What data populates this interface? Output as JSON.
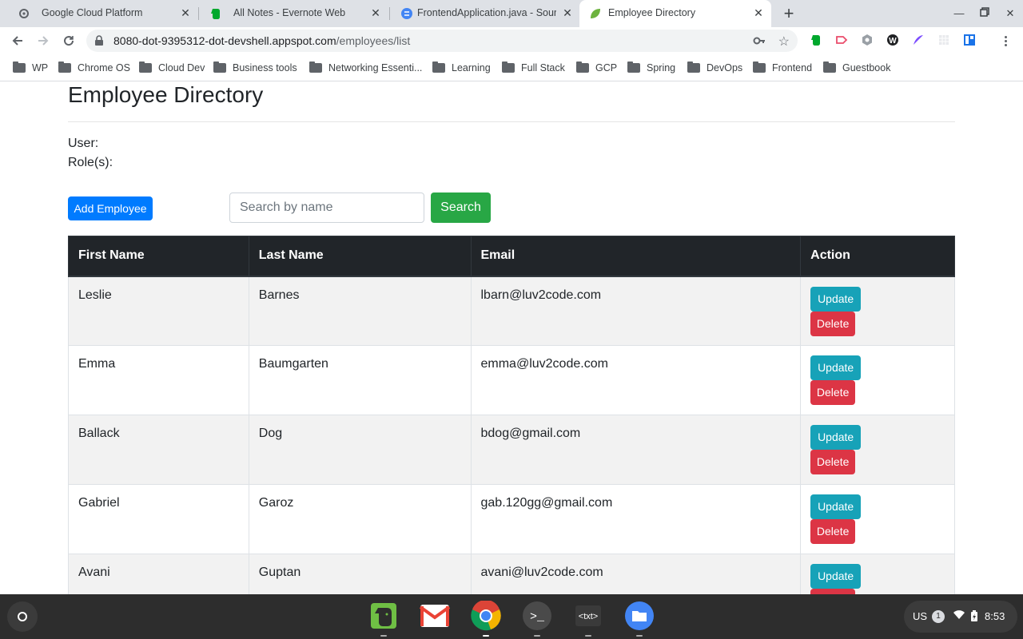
{
  "browser": {
    "tabs": [
      {
        "title": "Google Cloud Platform",
        "icon": "gcp-icon"
      },
      {
        "title": "All Notes - Evernote Web",
        "icon": "evernote-icon"
      },
      {
        "title": "FrontendApplication.java - Sourc",
        "icon": "source-icon"
      },
      {
        "title": "Employee Directory",
        "icon": "spring-leaf-icon",
        "active": true
      }
    ],
    "url_host": "8080-dot-9395312-dot-devshell.appspot.com",
    "url_path": "/employees/list",
    "bookmarks": [
      "WP",
      "Chrome OS",
      "Cloud Dev",
      "Business tools",
      "Networking Essenti...",
      "Learning",
      "Full Stack",
      "GCP",
      "Spring",
      "DevOps",
      "Frontend",
      "Guestbook"
    ]
  },
  "page": {
    "title": "Employee Directory",
    "user_label": "User:",
    "roles_label": "Role(s):",
    "add_button": "Add Employee",
    "search_placeholder": "Search by name",
    "search_button": "Search",
    "columns": [
      "First Name",
      "Last Name",
      "Email",
      "Action"
    ],
    "update_label": "Update",
    "delete_label": "Delete",
    "rows": [
      {
        "first": "Leslie",
        "last": "Barnes",
        "email": "lbarn@luv2code.com"
      },
      {
        "first": "Emma",
        "last": "Baumgarten",
        "email": "emma@luv2code.com"
      },
      {
        "first": "Ballack",
        "last": "Dog",
        "email": "bdog@gmail.com"
      },
      {
        "first": "Gabriel",
        "last": "Garoz",
        "email": "gab.120gg@gmail.com"
      },
      {
        "first": "Avani",
        "last": "Guptan",
        "email": "avani@luv2code.com"
      }
    ]
  },
  "shelf": {
    "apps": [
      "evernote-app-icon",
      "gmail-app-icon",
      "chrome-app-icon",
      "terminal-app-icon",
      "text-app-icon",
      "files-app-icon"
    ],
    "ime": "US",
    "notifications": "1",
    "time": "8:53"
  },
  "colors": {
    "primary": "#007bff",
    "success": "#28a745",
    "info": "#17a2b8",
    "danger": "#dc3545",
    "table_header": "#212529"
  }
}
